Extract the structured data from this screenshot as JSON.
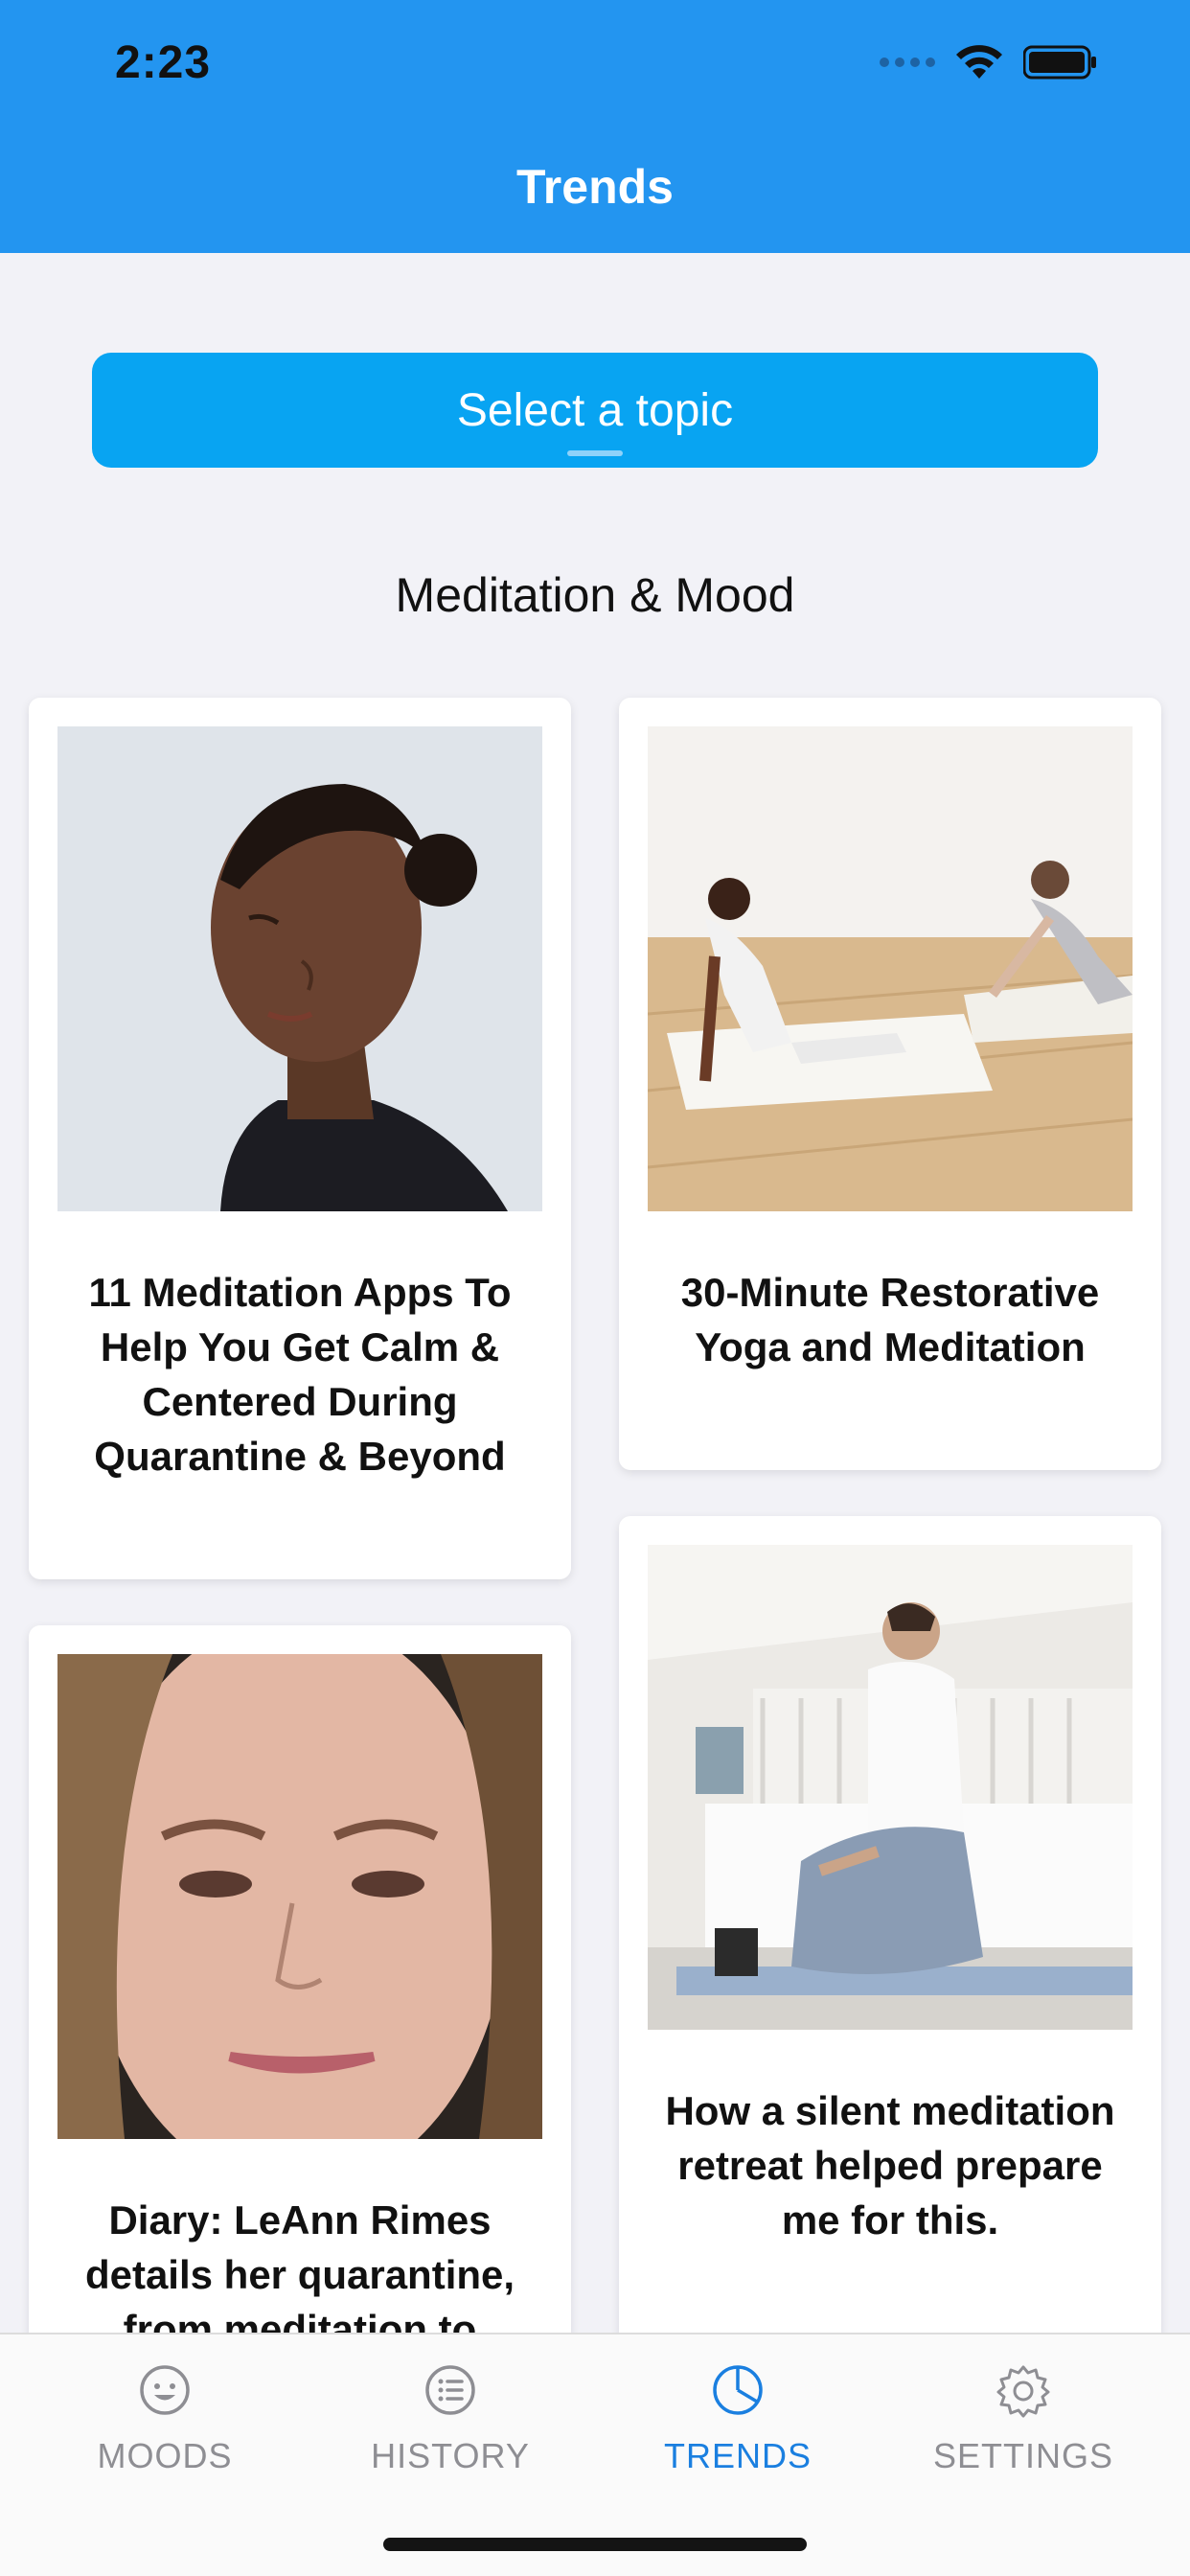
{
  "status_bar": {
    "time": "2:23"
  },
  "header": {
    "title": "Trends"
  },
  "topic_selector": {
    "label": "Select a topic"
  },
  "section": {
    "title": "Meditation & Mood"
  },
  "articles": [
    {
      "title": "11 Meditation Apps To Help You Get Calm & Centered During Quarantine & Beyond"
    },
    {
      "title": "30-Minute Restorative Yoga and Meditation"
    },
    {
      "title": "Diary: LeAnn Rimes details her quarantine, from meditation to"
    },
    {
      "title": "How a silent meditation retreat helped prepare me for this."
    }
  ],
  "tabs": [
    {
      "label": "MOODS",
      "icon": "smiley-icon",
      "active": false
    },
    {
      "label": "HISTORY",
      "icon": "list-icon",
      "active": false
    },
    {
      "label": "TRENDS",
      "icon": "pie-chart-icon",
      "active": true
    },
    {
      "label": "SETTINGS",
      "icon": "gear-icon",
      "active": false
    }
  ],
  "colors": {
    "header": "#2395f0",
    "topic_button": "#08a4f2",
    "active_tab": "#1a7fe0",
    "inactive_tab": "#8e8e93",
    "background": "#f2f2f7"
  }
}
